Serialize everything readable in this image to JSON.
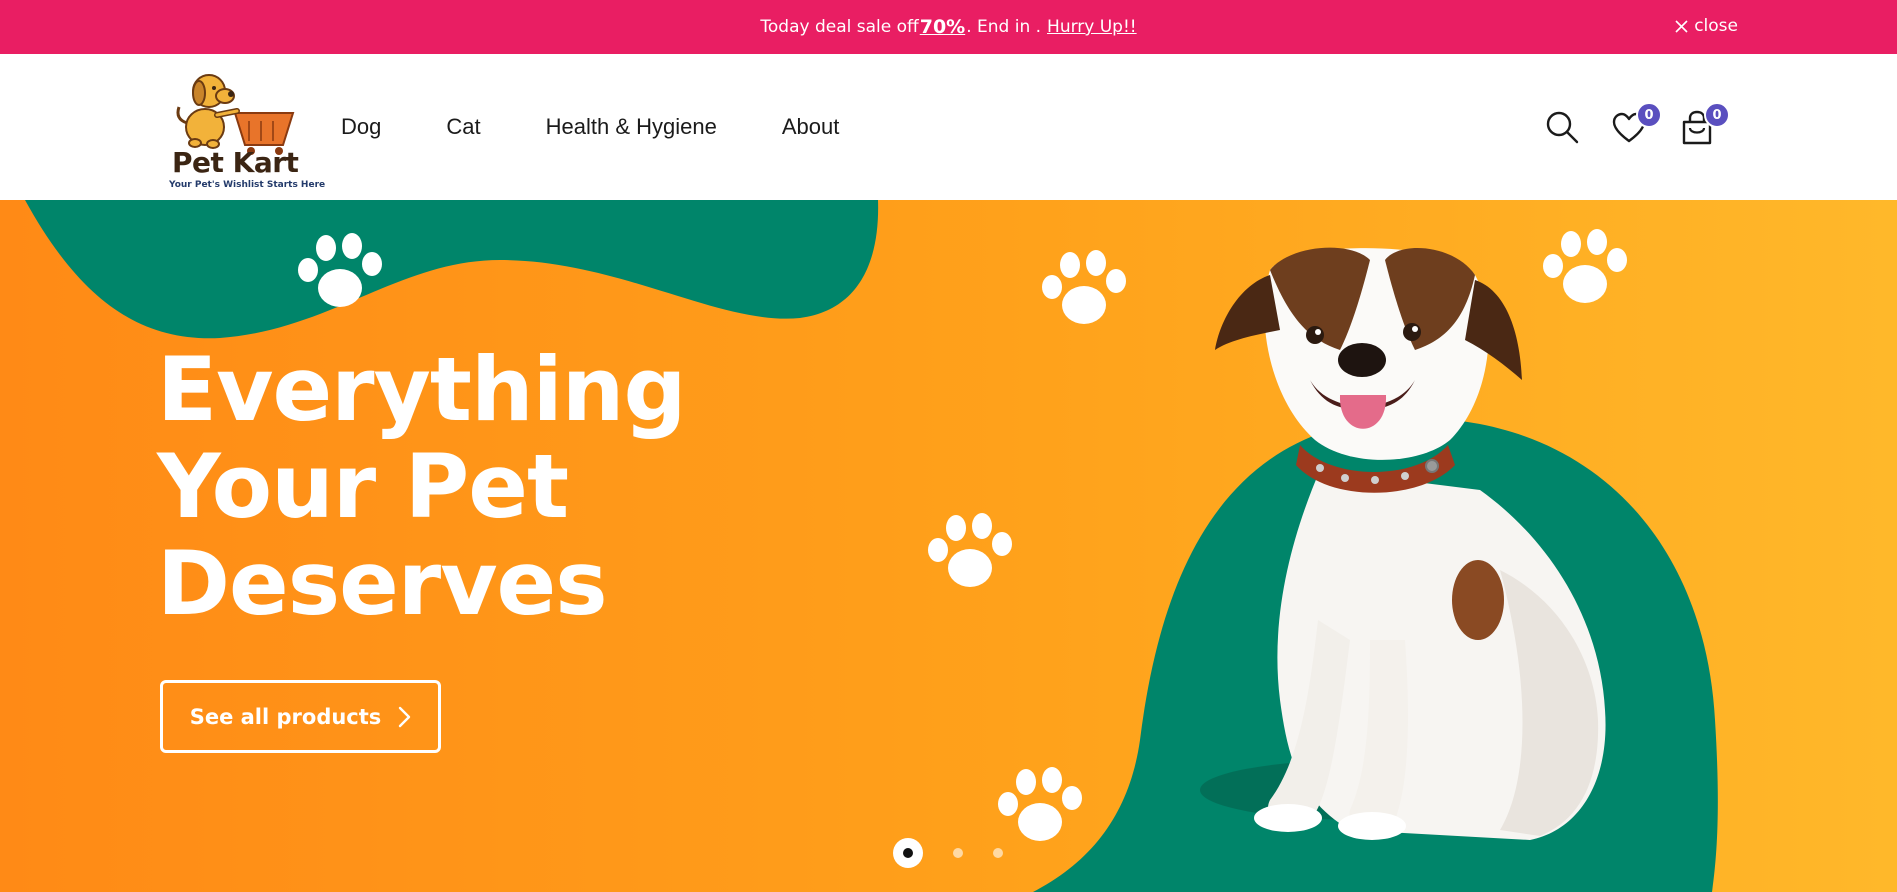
{
  "announcement": {
    "prefix": "Today deal sale off ",
    "discount": "70%",
    "middle": ". End in . ",
    "cta": "Hurry Up!!",
    "close_label": "close"
  },
  "header": {
    "logo_name": "Pet Kart",
    "logo_tagline": "Your Pet's Wishlist Starts Here",
    "nav": [
      "Dog",
      "Cat",
      "Health & Hygiene",
      "About"
    ],
    "wishlist_count": "0",
    "cart_count": "0"
  },
  "hero": {
    "title_lines": [
      "Everything",
      "Your Pet",
      "Deserves"
    ],
    "button_label": "See all products",
    "slides": 3,
    "active_slide": 1
  },
  "colors": {
    "announcement_bg": "#e91e63",
    "hero_orange": "#ff9a1c",
    "hero_green": "#00856a",
    "badge": "#5a4fbf"
  }
}
